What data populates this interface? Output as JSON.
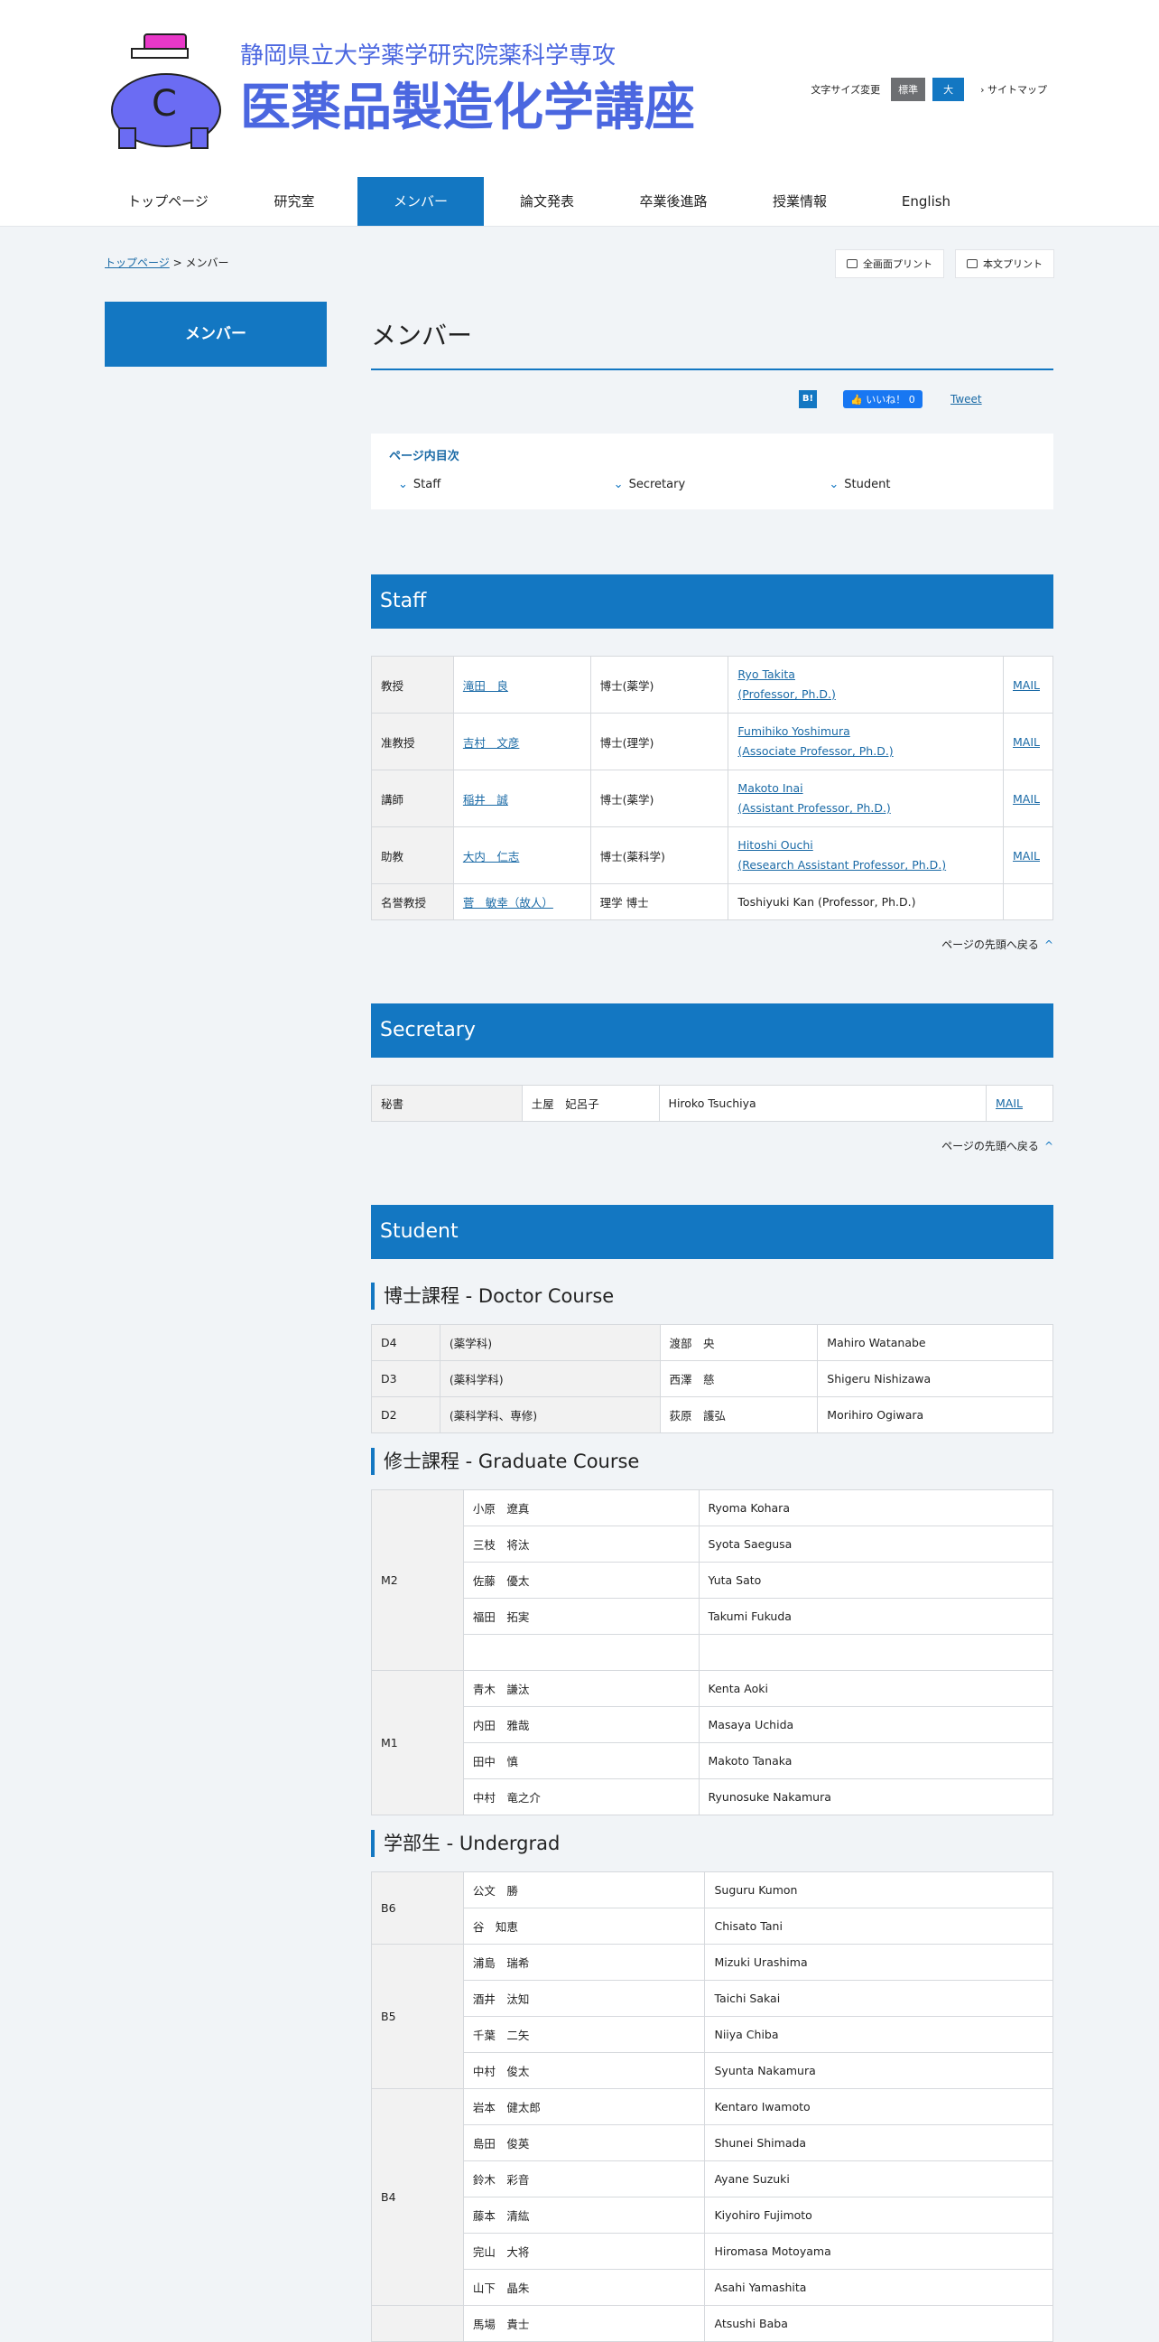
{
  "header": {
    "logo_title": "医薬品製造化学講座",
    "logo_subtitle": "静岡県立大学薬学研究院薬科学専攻",
    "font_size_label": "文字サイズ変更",
    "font_size_std": "標準",
    "font_size_large": "大",
    "sitemap": "サイトマップ"
  },
  "nav": [
    "トップページ",
    "研究室",
    "メンバー",
    "論文発表",
    "卒業後進路",
    "授業情報",
    "English"
  ],
  "breadcrumb": {
    "home": "トップページ",
    "sep": " > ",
    "current": "メンバー"
  },
  "print": {
    "full": "全画面プリント",
    "body": "本文プリント"
  },
  "sidenav": {
    "label": "メンバー"
  },
  "page_title": "メンバー",
  "social": {
    "hatena": "B!",
    "fb": "いいね！ 0",
    "tweet": "Tweet"
  },
  "toc": {
    "title": "ページ内目次",
    "items": [
      "Staff",
      "Secretary",
      "Student"
    ]
  },
  "staff": {
    "heading": "Staff",
    "rows": [
      {
        "role": "教授",
        "name": "滝田　良",
        "degree": "博士(薬学)",
        "en1": "Ryo Takita",
        "en2": "(Professor, Ph.D.)",
        "mail": "MAIL"
      },
      {
        "role": "准教授",
        "name": "吉村　文彦",
        "degree": "博士(理学)",
        "en1": "Fumihiko Yoshimura",
        "en2": "(Associate Professor, Ph.D.)",
        "mail": "MAIL"
      },
      {
        "role": "講師",
        "name": "稲井　誠",
        "degree": "博士(薬学)",
        "en1": "Makoto Inai",
        "en2": "(Assistant Professor, Ph.D.)",
        "mail": "MAIL"
      },
      {
        "role": "助教",
        "name": "大内　仁志",
        "degree": "博士(薬科学)",
        "en1": "Hitoshi Ouchi",
        "en2": "(Research Assistant Professor, Ph.D.)",
        "mail": "MAIL"
      },
      {
        "role": "名誉教授",
        "name": "菅　敏幸（故人）",
        "degree": "理学 博士",
        "en1": "Toshiyuki Kan (Professor, Ph.D.)",
        "en2": "",
        "mail": ""
      }
    ]
  },
  "back_to_top": "ページの先頭へ戻る",
  "secretary": {
    "heading": "Secretary",
    "role": "秘書",
    "name": "土屋　妃呂子",
    "en": "Hiroko Tsuchiya",
    "mail": "MAIL"
  },
  "student": {
    "heading": "Student",
    "doctor_heading": "博士課程 - Doctor Course",
    "doctor": [
      {
        "year": "D4",
        "dept": "(薬学科)",
        "name": "渡部　央",
        "en": "Mahiro Watanabe"
      },
      {
        "year": "D3",
        "dept": "(薬科学科)",
        "name": "西澤　慈",
        "en": "Shigeru Nishizawa"
      },
      {
        "year": "D2",
        "dept": "(薬科学科、専修)",
        "name": "荻原　護弘",
        "en": "Morihiro Ogiwara"
      }
    ],
    "graduate_heading": "修士課程 - Graduate Course",
    "m2_label": "M2",
    "m2": [
      {
        "name": "小原　遼真",
        "en": "Ryoma Kohara"
      },
      {
        "name": "三枝　将汰",
        "en": "Syota Saegusa"
      },
      {
        "name": "佐藤　優太",
        "en": "Yuta Sato"
      },
      {
        "name": "福田　拓実",
        "en": "Takumi Fukuda"
      }
    ],
    "m1_label": "M1",
    "m1": [
      {
        "name": "青木　謙汰",
        "en": "Kenta Aoki"
      },
      {
        "name": "内田　雅哉",
        "en": "Masaya Uchida"
      },
      {
        "name": "田中　慎",
        "en": "Makoto Tanaka"
      },
      {
        "name": "中村　竜之介",
        "en": "Ryunosuke Nakamura"
      }
    ],
    "undergrad_heading": "学部生 - Undergrad",
    "b6_label": "B6",
    "b6": [
      {
        "name": "公文　勝",
        "en": "Suguru Kumon"
      },
      {
        "name": "谷　知恵",
        "en": "Chisato Tani"
      }
    ],
    "b5_label": "B5",
    "b5": [
      {
        "name": "浦島　瑞希",
        "en": "Mizuki Urashima"
      },
      {
        "name": "酒井　汰知",
        "en": "Taichi Sakai"
      },
      {
        "name": "千葉　二矢",
        "en": "Niiya Chiba"
      },
      {
        "name": "中村　俊太",
        "en": "Syunta Nakamura"
      }
    ],
    "b4_label": "B4",
    "b4": [
      {
        "name": "岩本　健太郎",
        "en": "Kentaro Iwamoto"
      },
      {
        "name": "島田　俊英",
        "en": "Shunei Shimada"
      },
      {
        "name": "鈴木　彩音",
        "en": "Ayane Suzuki"
      },
      {
        "name": "藤本　清紘",
        "en": "Kiyohiro Fujimoto"
      },
      {
        "name": "完山　大将",
        "en": "Hiromasa Motoyama"
      },
      {
        "name": "山下　晶朱",
        "en": "Asahi Yamashita"
      },
      {
        "name": "馬場　貴士",
        "en": "Atsushi Baba"
      }
    ]
  }
}
